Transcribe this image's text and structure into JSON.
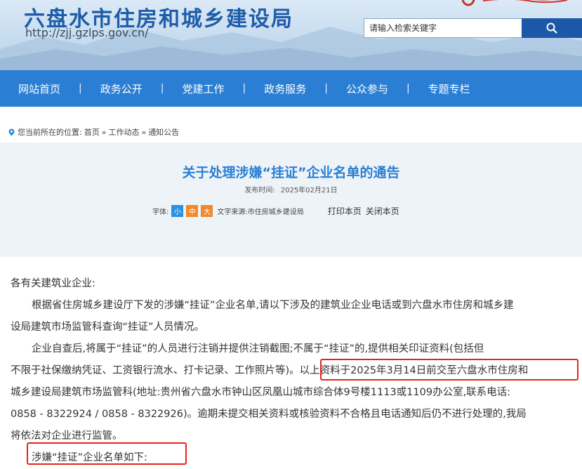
{
  "header": {
    "title": "六盘水市住房和城乡建设局",
    "url": "http://zjj.gzlps.gov.cn/",
    "logo_icon": "government-logo",
    "search_placeholder": "请输入检索关键字",
    "search_icon": "search-icon"
  },
  "nav": {
    "items": [
      "网站首页",
      "政务公开",
      "党建工作",
      "政务服务",
      "公众参与",
      "专题专栏"
    ]
  },
  "breadcrumb": {
    "prefix": "您当前所在的位置:",
    "items": [
      "首页",
      "»",
      "工作动态",
      "»",
      "通知公告"
    ]
  },
  "article": {
    "title": "关于处理涉嫌“挂证”企业名单的通告",
    "publish_label": "发布时间:",
    "publish_date": "2025年02月21日",
    "font_label": "字体:",
    "font_sizes": [
      "小",
      "中",
      "大"
    ],
    "source": "文字来源:市住房城乡建设局",
    "print_label": "打印本页",
    "close_label": "关闭本页",
    "paragraphs": [
      "各有关建筑业企业:",
      "根据省住房城乡建设厅下发的涉嫌“挂证”企业名单,请以下涉及的建筑业企业电话或到六盘水市住房和城乡建",
      "设局建筑市场监管科查询“挂证”人员情况。",
      "企业自查后,将属于“挂证”的人员进行注销并提供注销截图;不属于“挂证”的,提供相关印证资料(包括但",
      "不限于社保缴纳凭证、工资银行流水、打卡记录、工作照片等)。以上资料于2025年3月14日前交至六盘水市住房和",
      "城乡建设局建筑市场监管科(地址:贵州省六盘水市钟山区凤凰山城市综合体9号楼1113或1109办公室,联系电话:",
      "0858 - 8322924 / 0858 - 8322926)。逾期未提交相关资料或核验资料不合格且电话通知后仍不进行处理的,我局",
      "将依法对企业进行监管。",
      "涉嫌“挂证”企业名单如下:"
    ]
  },
  "colors": {
    "brand_blue": "#1f5da8",
    "nav_blue": "#2a7fd4",
    "highlight_red": "#e8231c",
    "font_orange": "#f0892b"
  }
}
